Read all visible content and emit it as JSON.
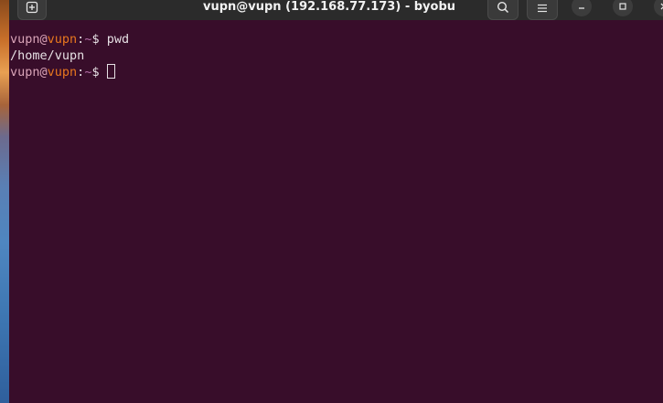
{
  "window": {
    "title": "vupn@vupn (192.168.77.173) - byobu",
    "buttons": {
      "new_tab_icon": "new-tab-icon",
      "search_icon": "search-icon",
      "menu_icon": "hamburger-menu-icon",
      "minimize_icon": "minimize-icon",
      "maximize_icon": "maximize-icon",
      "close_icon": "close-icon"
    }
  },
  "terminal": {
    "lines": [
      {
        "user": "vupn",
        "at": "@",
        "host": "vupn",
        "colon": ":",
        "path": "~",
        "dollar": "$ ",
        "command": "pwd"
      },
      {
        "output": "/home/vupn"
      },
      {
        "user": "vupn",
        "at": "@",
        "host": "vupn",
        "colon": ":",
        "path": "~",
        "dollar": "$ ",
        "command": ""
      }
    ]
  },
  "colors": {
    "terminal_background": "#380d2a",
    "titlebar_background": "#2b2b2b",
    "prompt_user": "#d9a4b8",
    "prompt_host": "#e8771e",
    "prompt_path": "#b46fa8",
    "text": "#e6e0e4"
  }
}
